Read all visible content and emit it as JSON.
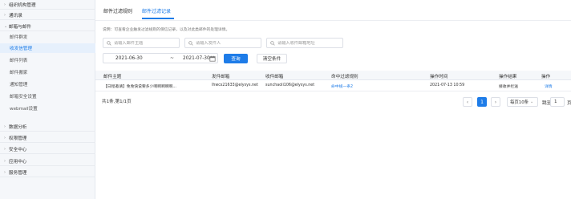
{
  "sidebar": {
    "items": [
      {
        "label": "组织机构管理",
        "arrow": "›",
        "type": "group"
      },
      {
        "label": "通讯录",
        "arrow": "›",
        "type": "group"
      },
      {
        "label": "邮箱与邮件",
        "arrow": "⌄",
        "type": "group"
      },
      {
        "label": "邮件群发",
        "type": "sub"
      },
      {
        "label": "收发信管理",
        "type": "sub-active"
      },
      {
        "label": "邮件列表",
        "type": "sub"
      },
      {
        "label": "邮件搬家",
        "type": "sub"
      },
      {
        "label": "通知管理",
        "type": "sub"
      },
      {
        "label": "邮箱安全设置",
        "type": "sub"
      },
      {
        "label": "webmail设置",
        "type": "sub"
      },
      {
        "label": "数据分析",
        "arrow": "›",
        "type": "group"
      },
      {
        "label": "权限管理",
        "arrow": "›",
        "type": "group"
      },
      {
        "label": "安全中心",
        "arrow": "›",
        "type": "group"
      },
      {
        "label": "应用中心",
        "arrow": "›",
        "type": "group"
      },
      {
        "label": "服务管理",
        "arrow": "›",
        "type": "group"
      }
    ]
  },
  "tabs": [
    {
      "label": "邮件过滤规则"
    },
    {
      "label": "邮件过滤记录"
    }
  ],
  "note": "说明：可查看企业触发过滤规则的保信记录，以及对此类邮件的处理详情。",
  "filters": {
    "subject_placeholder": "请输入邮件主题",
    "sender_placeholder": "请输入发件人",
    "recipient_placeholder": "请输入收件邮箱地址",
    "date_start": "2021-06-30",
    "date_sep": "~",
    "date_end": "2021-07-30",
    "search_label": "查询",
    "clear_label": "清空条件"
  },
  "table": {
    "columns": [
      "邮件主题",
      "发件邮箱",
      "收件邮箱",
      "命中过滤规则",
      "操作时间",
      "操作结果",
      "操作"
    ],
    "rows": [
      {
        "subject": "【日程邀请】免免快说要多少啊啊啊啊啊...",
        "sender": "lhwcs21633@elysys.net",
        "recipient": "sunchaoli106@elysys.net",
        "rule": "命中规一条2",
        "time": "2021-07-13 10:59",
        "result": "接收并拦送",
        "action": "详情"
      }
    ]
  },
  "pagination": {
    "total": "共1条,第1/1页",
    "current": "1",
    "page_size": "每页10条",
    "jump_label": "跳至",
    "jump_value": "1",
    "unit": "页"
  },
  "colors": {
    "accent": "#1e7ce8",
    "sidebar_bg": "#f5f7fa",
    "active_bg": "#e6f0fc"
  }
}
